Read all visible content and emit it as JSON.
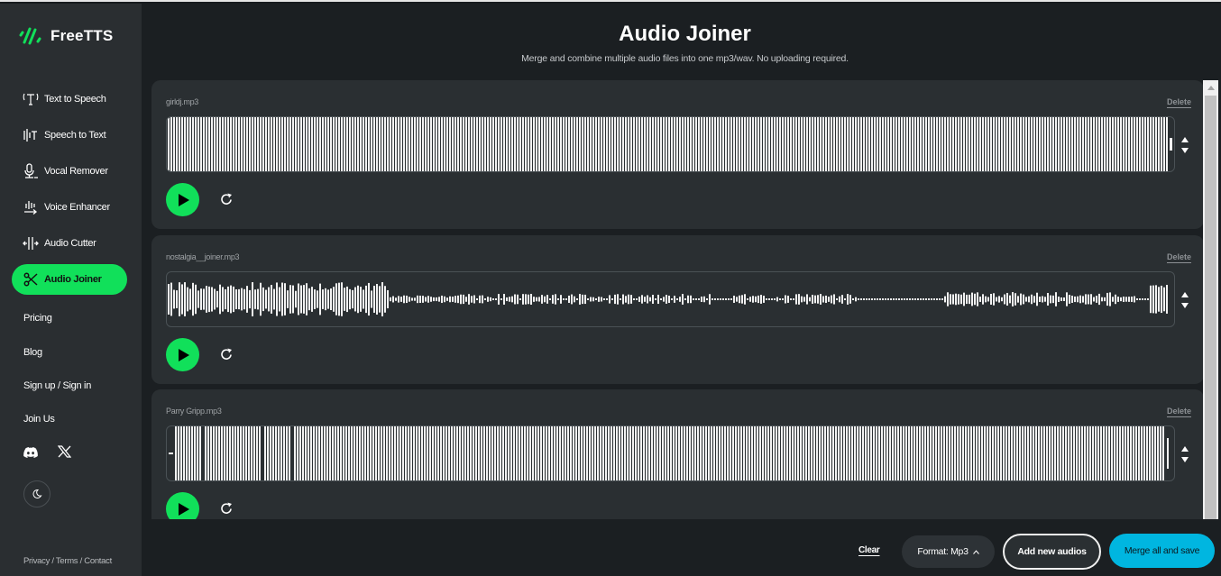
{
  "brand": {
    "name": "FreeTTS",
    "accent": "#11e05a"
  },
  "sidebar": {
    "tools": [
      {
        "label": "Text to Speech",
        "icon": "text-to-speech-icon",
        "active": false
      },
      {
        "label": "Speech to Text",
        "icon": "speech-to-text-icon",
        "active": false
      },
      {
        "label": "Vocal Remover",
        "icon": "microphone-icon",
        "active": false
      },
      {
        "label": "Voice Enhancer",
        "icon": "voice-enhancer-icon",
        "active": false
      },
      {
        "label": "Audio Cutter",
        "icon": "audio-cutter-icon",
        "active": false
      },
      {
        "label": "Audio Joiner",
        "icon": "scissors-icon",
        "active": true
      }
    ],
    "links": [
      {
        "label": "Pricing"
      },
      {
        "label": "Blog"
      },
      {
        "label": "Sign up / Sign in"
      },
      {
        "label": "Join Us"
      }
    ],
    "social": [
      "discord-icon",
      "x-icon"
    ],
    "theme_toggle_icon": "moon-icon",
    "footer": "Privacy / Terms / Contact"
  },
  "header": {
    "title": "Audio Joiner",
    "subtitle": "Merge and combine multiple audio files into one mp3/wav. No uploading required."
  },
  "tracks": [
    {
      "filename": "girldj.mp3",
      "delete_label": "Delete",
      "waveform": "dense"
    },
    {
      "filename": "nostalgia__joiner.mp3",
      "delete_label": "Delete",
      "waveform": "varied"
    },
    {
      "filename": "Parry Gripp.mp3",
      "delete_label": "Delete",
      "waveform": "dense-gaps"
    }
  ],
  "bottom_bar": {
    "clear_label": "Clear",
    "format_label": "Format: Mp3",
    "add_label": "Add new audios",
    "merge_label": "Merge all and save",
    "merge_color": "#00b6e0"
  }
}
